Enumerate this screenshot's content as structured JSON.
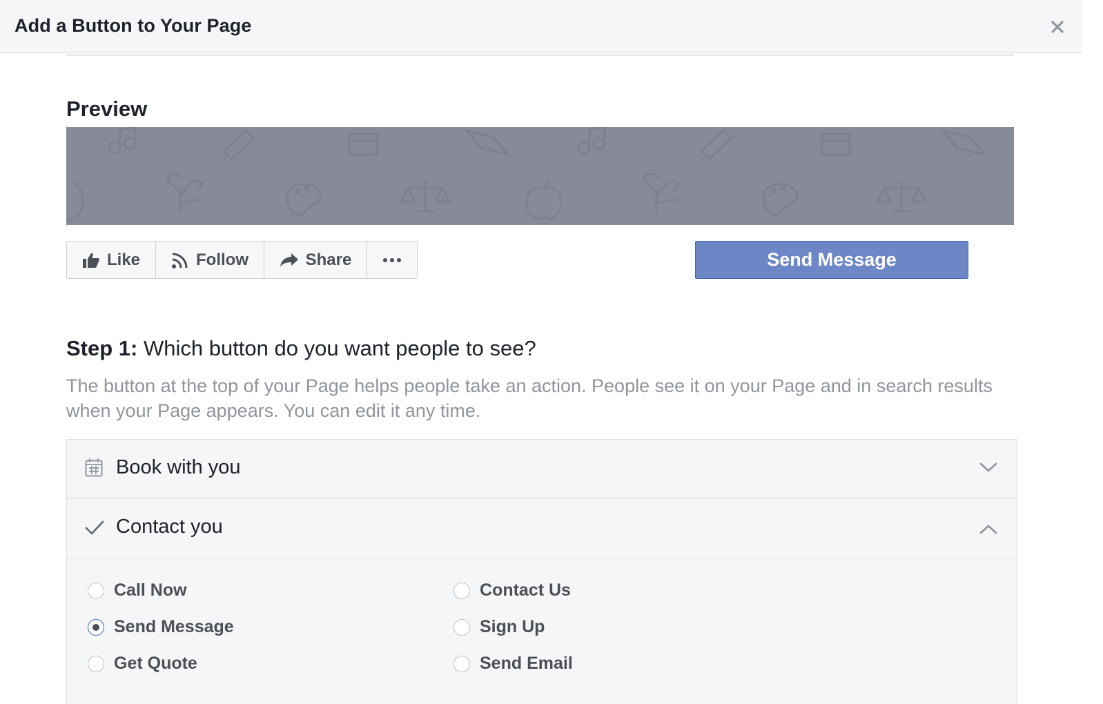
{
  "dialog": {
    "title": "Add a Button to Your Page",
    "close_icon": "close-icon"
  },
  "preview": {
    "heading": "Preview",
    "cover_color": "#878b97",
    "actions": [
      {
        "label": "Like",
        "icon": "thumbs-up-icon"
      },
      {
        "label": "Follow",
        "icon": "rss-icon"
      },
      {
        "label": "Share",
        "icon": "share-arrow-icon"
      },
      {
        "label": "",
        "icon": "more-dots-icon"
      }
    ],
    "cta_label": "Send Message",
    "cta_color": "#6d86c5"
  },
  "step1": {
    "prefix": "Step 1:",
    "question": " Which button do you want people to see?",
    "description": "The button at the top of your Page helps people take an action. People see it on your Page and in search results when your Page appears. You can edit it any time."
  },
  "accordion": {
    "sections": [
      {
        "label": "Book with you",
        "icon": "calendar-icon",
        "expanded": false
      },
      {
        "label": "Contact you",
        "icon": "checkmark-icon",
        "expanded": true
      }
    ],
    "options": {
      "call_now": "Call Now",
      "send_message": "Send Message",
      "get_quote": "Get Quote",
      "contact_us": "Contact Us",
      "sign_up": "Sign Up",
      "send_email": "Send Email"
    },
    "selected": "Send Message"
  }
}
